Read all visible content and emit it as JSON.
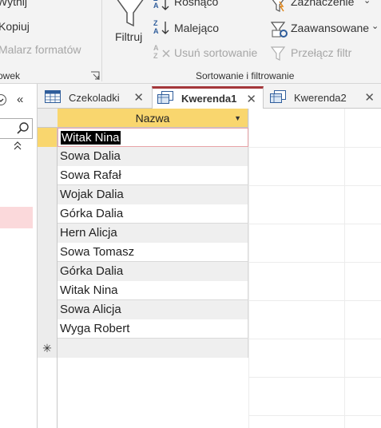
{
  "ribbon": {
    "clipboard": {
      "cut_label": "Wytnij",
      "copy_label": "Kopiuj",
      "format_painter_label": "Malarz formatów",
      "group_label": "owek"
    },
    "sort_filter": {
      "filter_label": "Filtruj",
      "ascending_label": "Rosnąco",
      "descending_label": "Malejąco",
      "remove_sort_label": "Usuń sortowanie",
      "selection_label": "Zaznaczenie",
      "advanced_label": "Zaawansowane",
      "toggle_filter_label": "Przełącz filtr",
      "group_label": "Sortowanie i filtrowanie"
    }
  },
  "tabs": [
    {
      "label": "Czekoladki",
      "active": false
    },
    {
      "label": "Kwerenda1",
      "active": true
    },
    {
      "label": "Kwerenda2",
      "active": false
    }
  ],
  "datasheet": {
    "column_header": "Nazwa",
    "rows": [
      "Witak Nina",
      "Sowa Dalia",
      "Sowa Rafał",
      "Wojak Dalia",
      "Górka Dalia",
      "Hern Alicja",
      "Sowa Tomasz",
      "Górka Dalia",
      "Witak Nina",
      "Sowa Alicja",
      "Wyga Robert"
    ],
    "new_record_marker": "✳"
  },
  "colors": {
    "accent": "#a4373a",
    "header_fill": "#f9d66e",
    "selection_border": "#e8a3a7",
    "nav_highlight": "#fbd9db"
  }
}
